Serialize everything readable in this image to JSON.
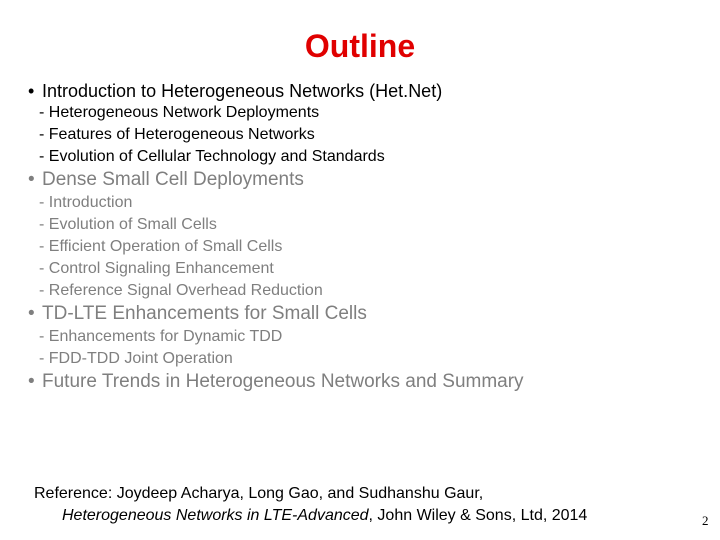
{
  "slide": {
    "title": "Outline",
    "title_color": "#e00000",
    "active_text_color": "#000000",
    "dim_text_color": "#7f7f7f",
    "bullet_glyph": "•",
    "sections": [
      {
        "label": "Introduction to Heterogeneous Networks (Het.Net)",
        "state": "active",
        "items": [
          "- Heterogeneous Network Deployments",
          "- Features of Heterogeneous Networks",
          "- Evolution of Cellular Technology and Standards"
        ]
      },
      {
        "label": "Dense Small Cell Deployments",
        "state": "dim",
        "items": [
          "- Introduction",
          "- Evolution of Small Cells",
          "- Efficient Operation of Small Cells",
          "- Control Signaling Enhancement",
          "- Reference Signal Overhead Reduction"
        ]
      },
      {
        "label": "TD-LTE Enhancements for Small Cells",
        "state": "dim",
        "items": [
          "- Enhancements for Dynamic TDD",
          "- FDD-TDD Joint Operation"
        ]
      },
      {
        "label": "Future Trends in Heterogeneous Networks and Summary",
        "state": "dim",
        "items": []
      }
    ],
    "reference": {
      "prefix": "Reference: Joydeep Acharya, Long Gao, and Sudhanshu Gaur,",
      "book_title": "Heterogeneous Networks in LTE-Advanced",
      "publisher_suffix": ", John Wiley & Sons, Ltd, 2014"
    },
    "page_number": "2"
  }
}
